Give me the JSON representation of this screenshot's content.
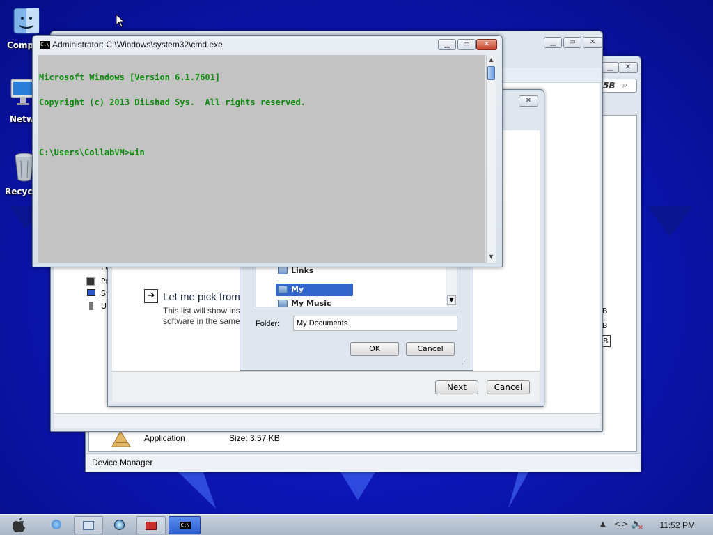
{
  "desktop": {
    "icons": [
      {
        "label": "Compu"
      },
      {
        "label": "Netw"
      },
      {
        "label": "Recycle"
      }
    ]
  },
  "device_manager": {
    "tree_items": [
      "Po",
      "Pr",
      "Sy",
      "Ur"
    ],
    "size_fragments": [
      "5B",
      "B",
      "B",
      "B"
    ],
    "file_type": "Application",
    "file_size": "Size: 3.57 KB",
    "status": "Device Manager"
  },
  "wizard": {
    "option_title": "Let me pick from",
    "option_desc_1": "This list will show inst",
    "option_desc_2": "software in the same",
    "next_label": "Next",
    "cancel_label": "Cancel"
  },
  "browse_dialog": {
    "folders": [
      {
        "name": "Links",
        "selected": false
      },
      {
        "name": "My Documents",
        "selected": true
      },
      {
        "name": "My Music",
        "selected": false
      }
    ],
    "folder_label": "Folder:",
    "folder_value": "My Documents",
    "ok_label": "OK",
    "cancel_label": "Cancel"
  },
  "cmd": {
    "title": "Administrator: C:\\Windows\\system32\\cmd.exe",
    "lines": [
      "Microsoft Windows [Version 6.1.7601]",
      "Copyright (c) 2013 DiLshad Sys.  All rights reserved.",
      "",
      "C:\\Users\\CollabVM>win"
    ]
  },
  "taskbar": {
    "clock": "11:52 PM"
  },
  "colors": {
    "console_bg": "#c3c3c3",
    "console_text": "#0b8a0b",
    "selection": "#3366cc",
    "desktop": "#0d17b8"
  }
}
